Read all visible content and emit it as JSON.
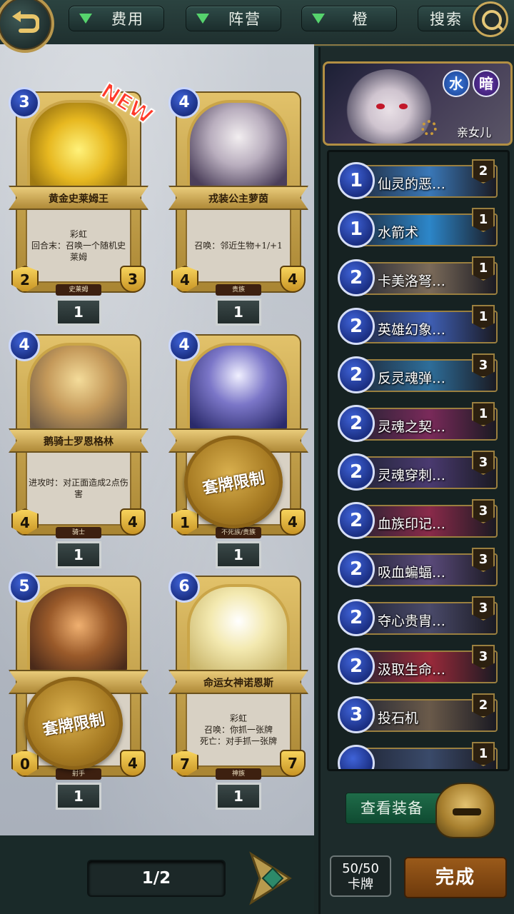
{
  "filters": {
    "cost_label": "费用",
    "faction_label": "阵营",
    "rarity_label": "橙",
    "search_label": "搜索"
  },
  "cards": [
    {
      "name": "黄金史莱姆王",
      "cost": "3",
      "attack": "2",
      "health": "3",
      "tribe": "史莱姆",
      "desc": "彩虹\n回合末：召唤一个随机史莱姆",
      "count": "1",
      "is_new": true,
      "new_label": "NEW",
      "locked": false
    },
    {
      "name": "戎装公主萝茵",
      "cost": "4",
      "attack": "4",
      "health": "4",
      "tribe": "贵族",
      "desc": "召唤：邻近生物+1/+1",
      "count": "1",
      "is_new": false,
      "locked": false
    },
    {
      "name": "鹅骑士罗恩格林",
      "cost": "4",
      "attack": "4",
      "health": "4",
      "tribe": "骑士",
      "desc": "进攻时：对正面造成2点伤害",
      "count": "1",
      "is_new": false,
      "locked": false
    },
    {
      "name": "",
      "cost": "4",
      "attack": "1",
      "health": "4",
      "tribe": "不死族/贵族",
      "desc": "",
      "count": "1",
      "is_new": false,
      "locked": true,
      "lock_label": "套牌限制"
    },
    {
      "name": "",
      "cost": "5",
      "attack": "0",
      "health": "4",
      "tribe": "射手",
      "desc": "",
      "count": "1",
      "is_new": false,
      "locked": true,
      "lock_label": "套牌限制"
    },
    {
      "name": "命运女神诺恩斯",
      "cost": "6",
      "attack": "7",
      "health": "7",
      "tribe": "神族",
      "desc": "彩虹\n召唤：你抓一张牌\n死亡：对手抓一张牌",
      "count": "1",
      "is_new": false,
      "locked": false
    }
  ],
  "pager": {
    "label": "1/2"
  },
  "hero": {
    "name": "亲女儿",
    "element_water": "水",
    "element_dark": "暗"
  },
  "deck": [
    {
      "cost": "1",
      "name": "仙灵的恶…",
      "qty": "2",
      "color": "#3a78b8"
    },
    {
      "cost": "1",
      "name": "水箭术",
      "qty": "1",
      "color": "#2c86c9"
    },
    {
      "cost": "2",
      "name": "卡美洛弩…",
      "qty": "1",
      "color": "#7b6b5a"
    },
    {
      "cost": "2",
      "name": "英雄幻象…",
      "qty": "1",
      "color": "#3f5fb4"
    },
    {
      "cost": "2",
      "name": "反灵魂弹…",
      "qty": "3",
      "color": "#2e6e9a"
    },
    {
      "cost": "2",
      "name": "灵魂之契…",
      "qty": "1",
      "color": "#7a2a5a"
    },
    {
      "cost": "2",
      "name": "灵魂穿刺…",
      "qty": "3",
      "color": "#4a3a70"
    },
    {
      "cost": "2",
      "name": "血族印记…",
      "qty": "3",
      "color": "#8a2a4a"
    },
    {
      "cost": "2",
      "name": "吸血蝙蝠…",
      "qty": "3",
      "color": "#5a4a7a"
    },
    {
      "cost": "2",
      "name": "夺心贵胄…",
      "qty": "3",
      "color": "#4a4a6a"
    },
    {
      "cost": "2",
      "name": "汲取生命…",
      "qty": "3",
      "color": "#9a2a3a"
    },
    {
      "cost": "3",
      "name": "投石机",
      "qty": "2",
      "color": "#6a5a4a"
    },
    {
      "cost": "",
      "name": "",
      "qty": "1",
      "color": "#3a4a6a"
    }
  ],
  "view_gear_label": "查看装备",
  "deck_count": {
    "value": "50/50",
    "unit": "卡牌"
  },
  "done_label": "完成"
}
